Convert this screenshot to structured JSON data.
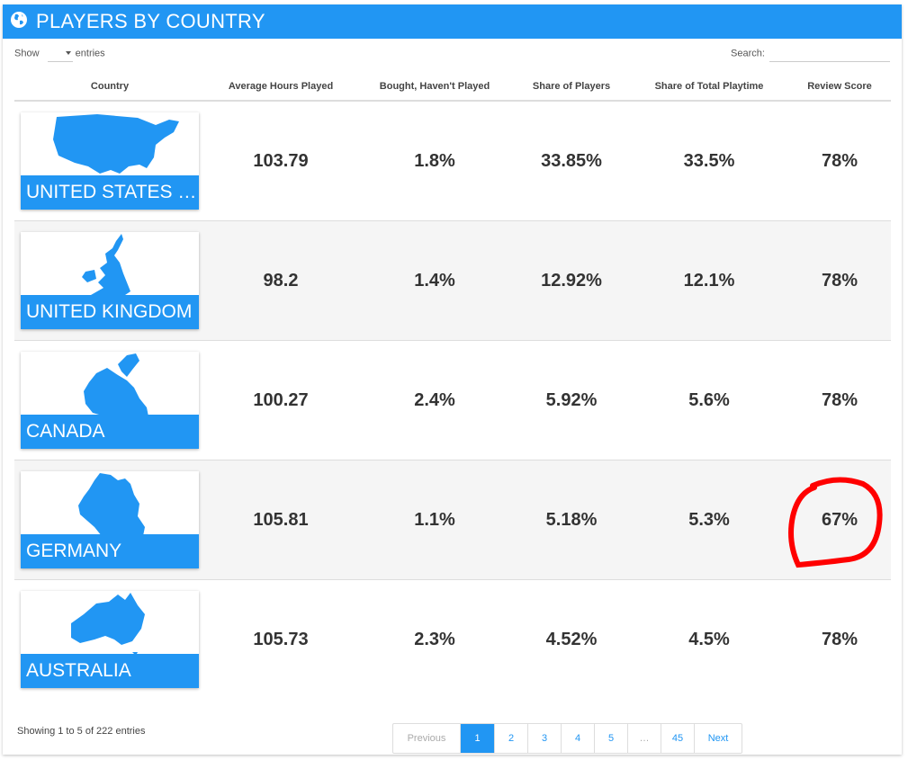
{
  "header": {
    "title": "PLAYERS BY COUNTRY",
    "icon": "globe-icon",
    "color": "#2196f3"
  },
  "controls": {
    "show_label": "Show",
    "entries_label": "entries",
    "search_label": "Search:"
  },
  "columns": [
    "Country",
    "Average Hours Played",
    "Bought, Haven't Played",
    "Share of Players",
    "Share of Total Playtime",
    "Review Score"
  ],
  "rows": [
    {
      "country": "UNITED STATES O...",
      "avg_hours": "103.79",
      "bought_not_played": "1.8%",
      "share_players": "33.85%",
      "share_playtime": "33.5%",
      "review": "78%"
    },
    {
      "country": "UNITED KINGDOM",
      "avg_hours": "98.2",
      "bought_not_played": "1.4%",
      "share_players": "12.92%",
      "share_playtime": "12.1%",
      "review": "78%"
    },
    {
      "country": "CANADA",
      "avg_hours": "100.27",
      "bought_not_played": "2.4%",
      "share_players": "5.92%",
      "share_playtime": "5.6%",
      "review": "78%"
    },
    {
      "country": "GERMANY",
      "avg_hours": "105.81",
      "bought_not_played": "1.1%",
      "share_players": "5.18%",
      "share_playtime": "5.3%",
      "review": "67%"
    },
    {
      "country": "AUSTRALIA",
      "avg_hours": "105.73",
      "bought_not_played": "2.3%",
      "share_players": "4.52%",
      "share_playtime": "4.5%",
      "review": "78%"
    }
  ],
  "footer": {
    "info": "Showing 1 to 5 of 222 entries"
  },
  "pagination": {
    "previous": "Previous",
    "pages": [
      "1",
      "2",
      "3",
      "4",
      "5",
      "…",
      "45"
    ],
    "active": "1",
    "next": "Next"
  },
  "annotation_color": "#ff0000"
}
